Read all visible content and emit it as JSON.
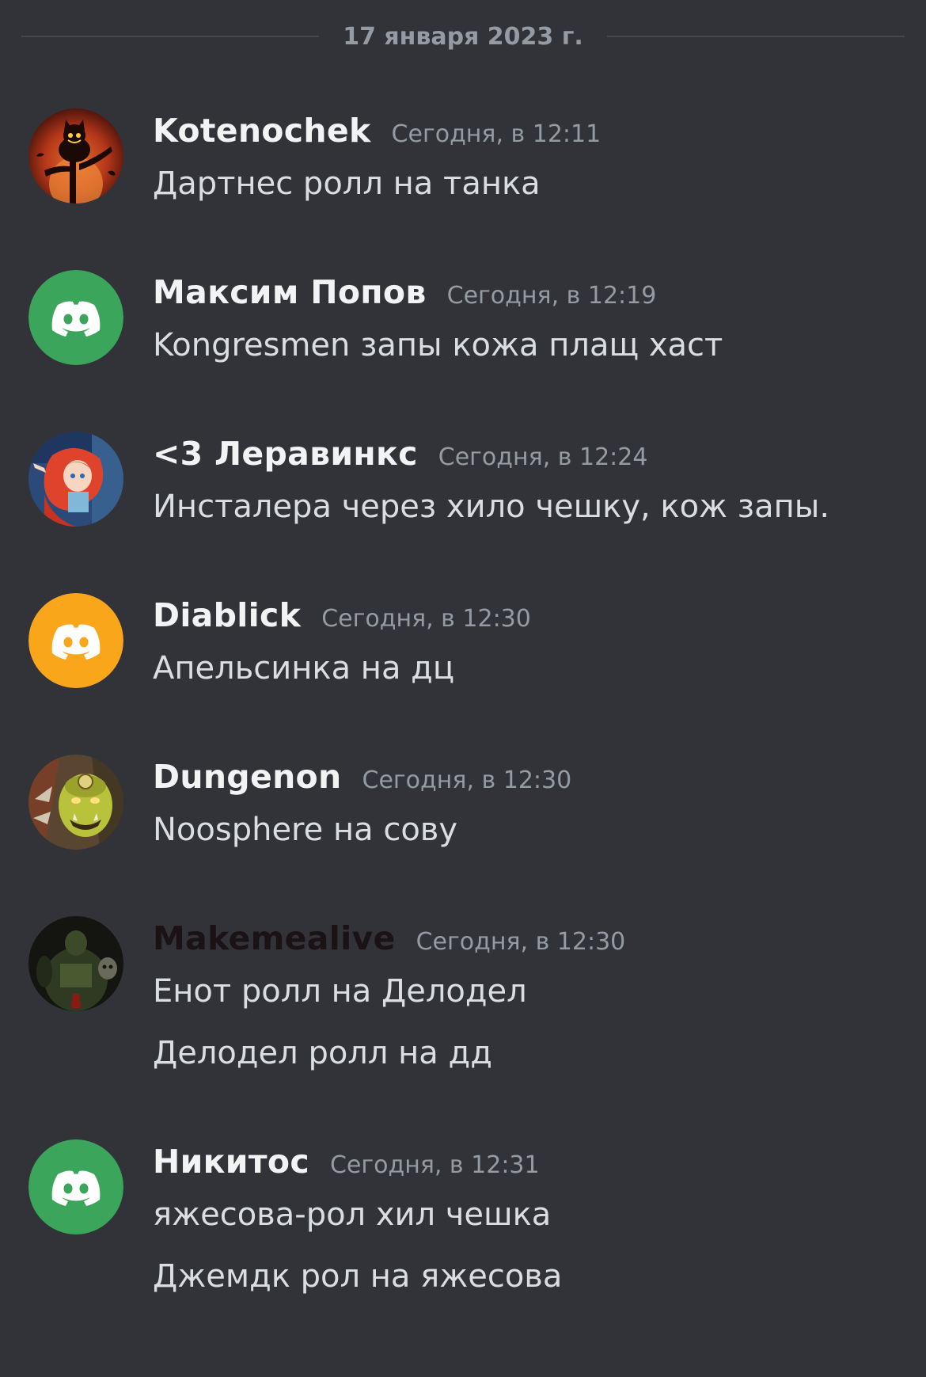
{
  "date_divider": "17 января 2023 г.",
  "messages": [
    {
      "username": "Kotenochek",
      "timestamp": "Сегодня, в 12:11",
      "lines": [
        "Дартнес ролл на танка"
      ],
      "avatar": "cat-silhouette-avatar"
    },
    {
      "username": "Максим Попов",
      "timestamp": "Сегодня, в 12:19",
      "lines": [
        "Kongresmen запы кожа плащ хаст"
      ],
      "avatar": "discord-default-avatar",
      "avatar_color": "#3ba55c"
    },
    {
      "username": "<3 Леравинкс",
      "timestamp": "Сегодня, в 12:24",
      "lines": [
        "Инсталера через хило чешку, кож запы."
      ],
      "avatar": "anime-girl-avatar"
    },
    {
      "username": "Diablick",
      "timestamp": "Сегодня, в 12:30",
      "lines": [
        "Апельсинка на дц"
      ],
      "avatar": "discord-default-avatar",
      "avatar_color": "#faa61a"
    },
    {
      "username": "Dungenon",
      "timestamp": "Сегодня, в 12:30",
      "lines": [
        "Noosphere на сову"
      ],
      "avatar": "orc-avatar"
    },
    {
      "username": "Makemealive",
      "timestamp": "Сегодня, в 12:30",
      "lines": [
        "Енот ролл на Делодел",
        "Делодел ролл на дд"
      ],
      "avatar": "dark-warrior-avatar"
    },
    {
      "username": "Никитос",
      "timestamp": "Сегодня, в 12:31",
      "lines": [
        "яжесова-рол хил чешка",
        "Джемдк рол на яжесова"
      ],
      "avatar": "discord-default-avatar",
      "avatar_color": "#3ba55c"
    }
  ]
}
